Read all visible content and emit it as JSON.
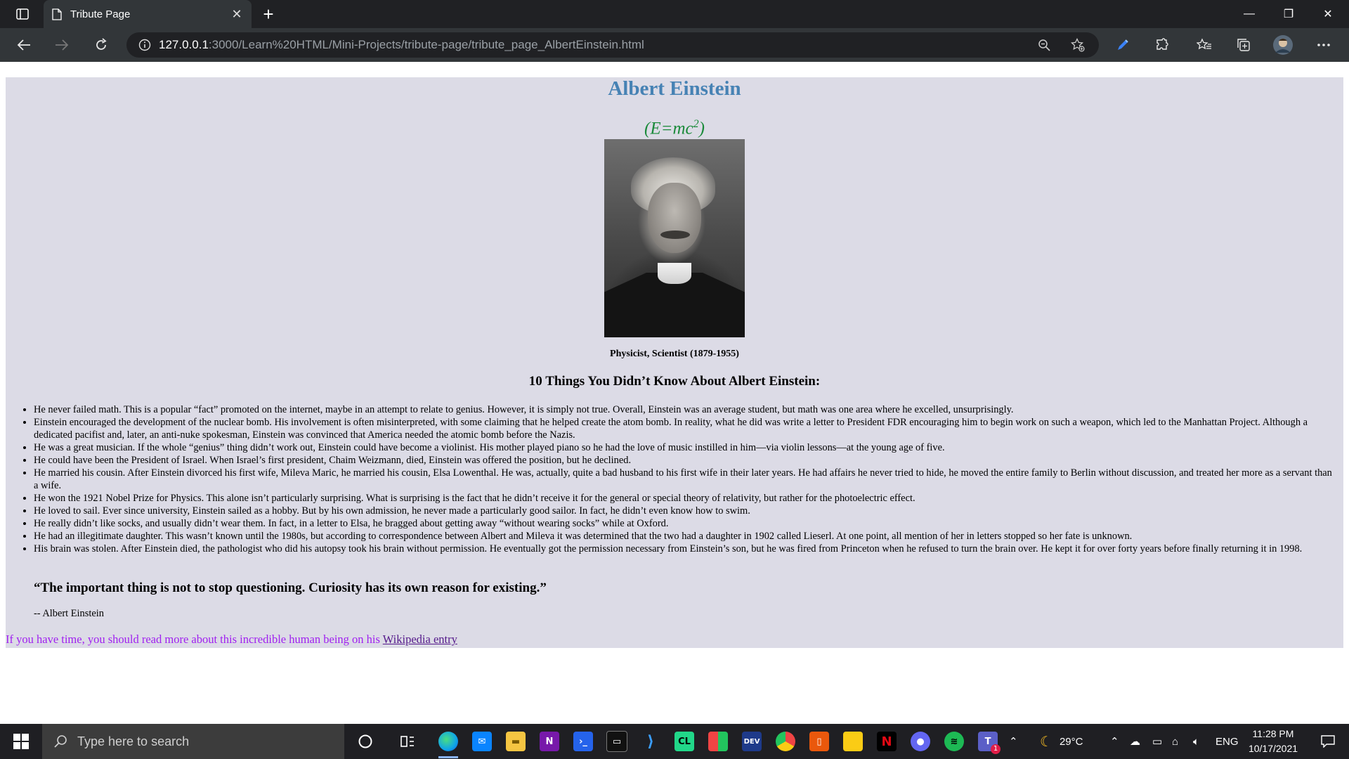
{
  "browser": {
    "tab_title": "Tribute Page",
    "url_host": "127.0.0.1",
    "url_rest": ":3000/Learn%20HTML/Mini-Projects/tribute-page/tribute_page_AlbertEinstein.html"
  },
  "page": {
    "title": "Albert Einstein",
    "formula_pre": "(E=mc",
    "formula_sup": "2",
    "formula_post": ")",
    "caption": "Physicist, Scientist (1879-1955)",
    "subtitle": "10 Things You Didn’t Know About Albert Einstein:",
    "facts": [
      "He never failed math. This is a popular “fact” promoted on the internet, maybe in an attempt to relate to genius. However, it is simply not true. Overall, Einstein was an average student, but math was one area where he excelled, unsurprisingly.",
      "Einstein encouraged the development of the nuclear bomb. His involvement is often misinterpreted, with some claiming that he helped create the atom bomb. In reality, what he did was write a letter to President FDR encouraging him to begin work on such a weapon, which led to the Manhattan Project. Although a dedicated pacifist and, later, an anti-nuke spokesman, Einstein was convinced that America needed the atomic bomb before the Nazis.",
      "He was a great musician. If the whole “genius” thing didn’t work out, Einstein could have become a violinist. His mother played piano so he had the love of music instilled in him—via violin lessons—at the young age of five.",
      "He could have been the President of Israel. When Israel’s first president, Chaim Weizmann, died, Einstein was offered the position, but he declined.",
      "He married his cousin. After Einstein divorced his first wife, Mileva Maric, he married his cousin, Elsa Lowenthal. He was, actually, quite a bad husband to his first wife in their later years. He had affairs he never tried to hide, he moved the entire family to Berlin without discussion, and treated her more as a servant than a wife.",
      "He won the 1921 Nobel Prize for Physics. This alone isn’t particularly surprising. What is surprising is the fact that he didn’t receive it for the general or special theory of relativity, but rather for the photoelectric effect.",
      "He loved to sail. Ever since university, Einstein sailed as a hobby. But by his own admission, he never made a particularly good sailor. In fact, he didn’t even know how to swim.",
      "He really didn’t like socks, and usually didn’t wear them. In fact, in a letter to Elsa, he bragged about getting away “without wearing socks” while at Oxford.",
      "He had an illegitimate daughter. This wasn’t known until the 1980s, but according to correspondence between Albert and Mileva it was determined that the two had a daughter in 1902 called Lieserl. At one point, all mention of her in letters stopped so her fate is unknown.",
      "His brain was stolen. After Einstein died, the pathologist who did his autopsy took his brain without permission. He eventually got the permission necessary from Einstein’s son, but he was fired from Princeton when he refused to turn the brain over. He kept it for over forty years before finally returning it in 1998."
    ],
    "quote": "“The important thing is not to stop questioning. Curiosity has its own reason for existing.”",
    "attribution": "-- Albert Einstein",
    "footer_text": "If you have time, you should read more about this incredible human being on his ",
    "footer_link": "Wikipedia entry"
  },
  "taskbar": {
    "search_placeholder": "Type here to search",
    "temperature": "29°C",
    "language": "ENG",
    "time": "11:28 PM",
    "date": "10/17/2021",
    "teams_badge": "1"
  },
  "colors": {
    "page_bg": "#dcdbe6",
    "title": "#4682b4",
    "formula": "#1a8a3a",
    "footer": "#a020f0"
  }
}
